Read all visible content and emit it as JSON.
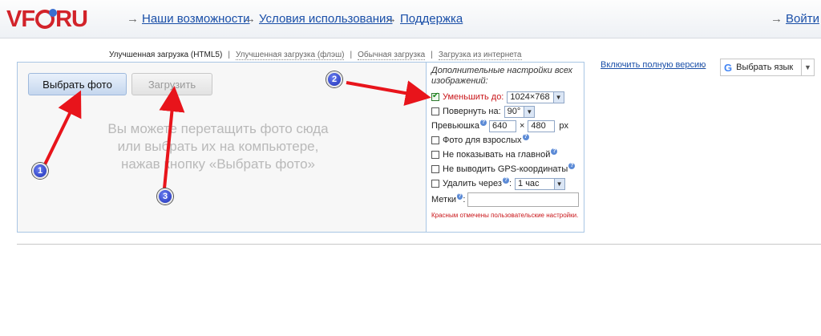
{
  "header": {
    "logo_text_left": "VF",
    "logo_text_right": "RU",
    "nav": [
      {
        "label": "Наши возможности"
      },
      {
        "label": "Условия использования"
      },
      {
        "label": "Поддержка"
      }
    ],
    "login_label": "Войти",
    "arrow": "→"
  },
  "tabs": [
    {
      "label": "Улучшенная загрузка (HTML5)",
      "active": true
    },
    {
      "label": "Улучшенная загрузка (флэш)",
      "active": false
    },
    {
      "label": "Обычная загрузка",
      "active": false
    },
    {
      "label": "Загрузка из интернета",
      "active": false
    }
  ],
  "tab_separator": "|",
  "upload": {
    "choose_label": "Выбрать фото",
    "upload_label": "Загрузить",
    "drop_hint": "Вы можете перетащить фото сюда\nили выбрать их на компьютере,\nнажав кнопку «Выбрать фото»"
  },
  "settings": {
    "title": "Дополнительные настройки всех изображений:",
    "resize": {
      "label": "Уменьшить до:",
      "checked": true,
      "value": "1024×768"
    },
    "rotate": {
      "label": "Повернуть на:",
      "checked": false,
      "value": "90°"
    },
    "thumb": {
      "label": "Превьюшка",
      "width": "640",
      "times": "×",
      "height": "480",
      "unit": "px"
    },
    "adult": {
      "label": "Фото для взрослых",
      "checked": false
    },
    "hide_main": {
      "label": "Не показывать на главной",
      "checked": false
    },
    "no_gps": {
      "label": "Не выводить GPS-координаты",
      "checked": false
    },
    "delete": {
      "label": "Удалить через",
      "checked": false,
      "value": "1 час"
    },
    "tags": {
      "label": "Метки",
      "value": ""
    },
    "help_mark": "?",
    "note": "Красным отмечены пользовательские настройки."
  },
  "sidebar": {
    "full_version": "Включить полную версию",
    "full_version_dot": ".",
    "language": "Выбрать язык",
    "language_logo": "G",
    "dropdown_glyph": "▼"
  },
  "annotations": {
    "badge1": "1",
    "badge2": "2",
    "badge3": "3",
    "arrow_color": "#e8141b"
  },
  "colors": {
    "brand": "#d2232a",
    "link": "#1a4fa8",
    "highlight_red": "#c9161a"
  }
}
